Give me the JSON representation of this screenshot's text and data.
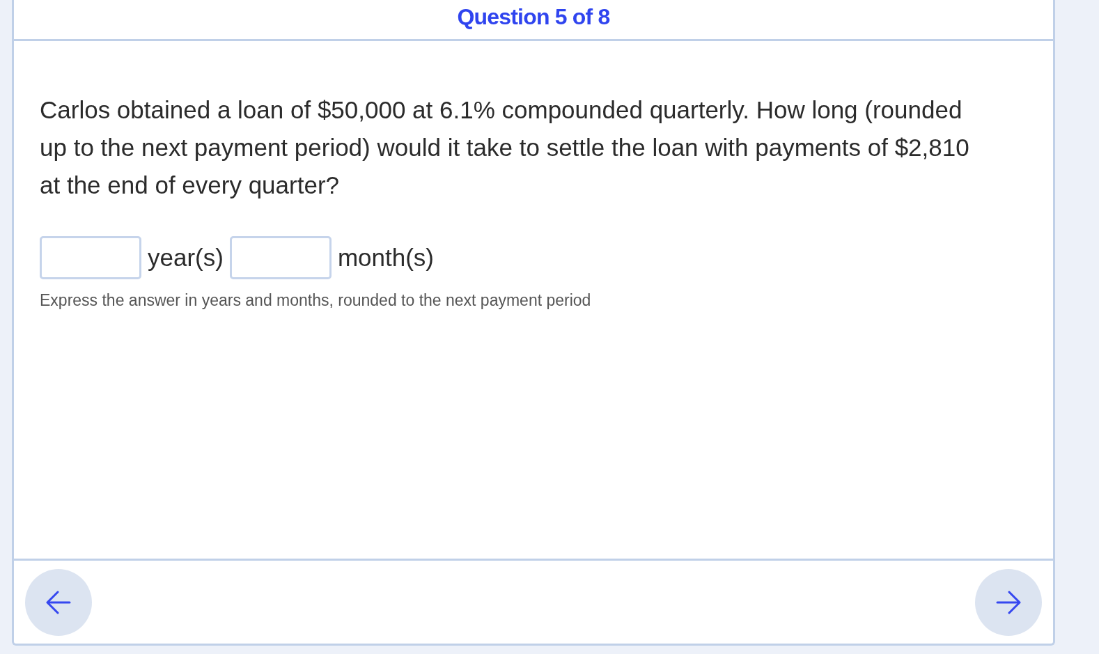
{
  "header": {
    "title": "Question 5 of 8"
  },
  "question": {
    "text": "Carlos obtained a loan of $50,000 at 6.1% compounded quarterly. How long (rounded up to the next payment period) would it take to settle the loan with payments of $2,810 at the end of every quarter?"
  },
  "answer": {
    "fields": [
      {
        "unit": "year(s)"
      },
      {
        "unit": "month(s)"
      }
    ],
    "hint": "Express the answer in years and months, rounded to the next payment period"
  }
}
